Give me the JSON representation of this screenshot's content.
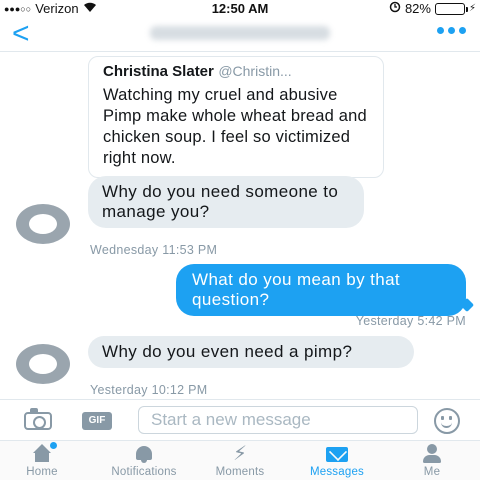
{
  "status_bar": {
    "signal": "●●●○○",
    "carrier": "Verizon",
    "wifi_icon": "wifi-icon",
    "time": "12:50 AM",
    "battery": "82%",
    "battery_level": 0.82,
    "charging_icon": "⚡"
  },
  "nav": {
    "back_label": "<",
    "more_icon": "more-dots-icon"
  },
  "tweet_card": {
    "author": "Christina Slater",
    "handle": "@Christin...",
    "text": "Watching my cruel and abusive Pimp make whole wheat bread and chicken soup. I feel so victimized right now."
  },
  "messages": [
    {
      "direction": "in",
      "text": "Why do you need someone to manage you?",
      "time": "Wednesday 11:53 PM"
    },
    {
      "direction": "out",
      "text": "What do you mean by that question?",
      "time": "Yesterday 5:42 PM"
    },
    {
      "direction": "in",
      "text": "Why do you even need a pimp?",
      "time": "Yesterday 10:12 PM"
    }
  ],
  "composer": {
    "gif_label": "GIF",
    "placeholder": "Start a new message"
  },
  "tabs": [
    {
      "label": "Home",
      "icon": "home-icon",
      "active": false
    },
    {
      "label": "Notifications",
      "icon": "bell-icon",
      "active": false
    },
    {
      "label": "Moments",
      "icon": "lightning-icon",
      "active": false
    },
    {
      "label": "Messages",
      "icon": "envelope-icon",
      "active": true
    },
    {
      "label": "Me",
      "icon": "person-icon",
      "active": false
    }
  ],
  "colors": {
    "accent": "#1da1f2",
    "incoming_bubble": "#e6ecf0",
    "muted": "#8899a6"
  }
}
